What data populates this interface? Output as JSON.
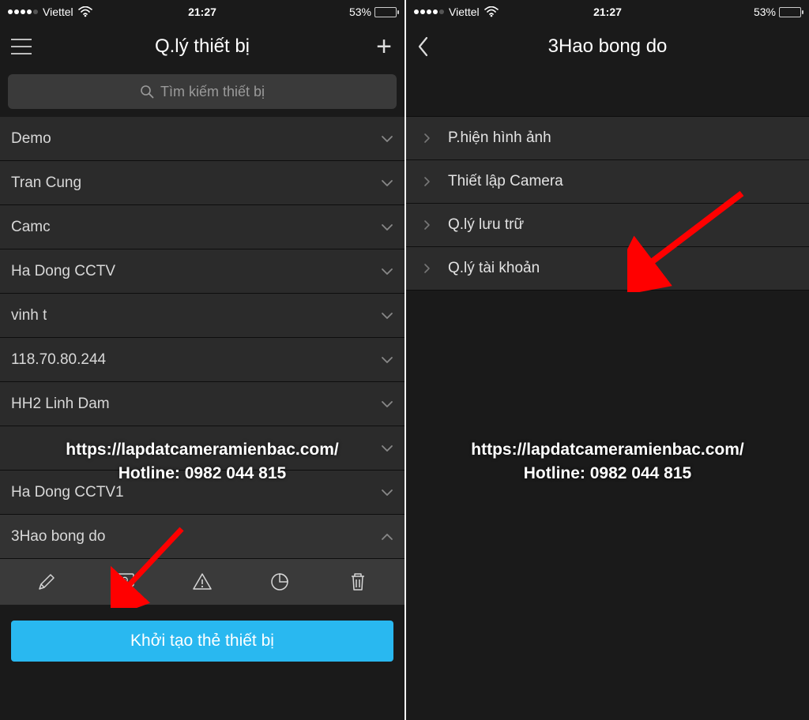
{
  "left": {
    "status": {
      "carrier": "Viettel",
      "time": "21:27",
      "battery_pct": "53%",
      "battery_fill": 53
    },
    "title": "Q.lý thiết bị",
    "search_placeholder": "Tìm kiếm thiết bị",
    "devices": [
      {
        "name": "Demo",
        "expanded": false
      },
      {
        "name": "Tran Cung",
        "expanded": false
      },
      {
        "name": "Camc",
        "expanded": false
      },
      {
        "name": "Ha Dong CCTV",
        "expanded": false
      },
      {
        "name": "vinh t",
        "expanded": false
      },
      {
        "name": "118.70.80.244",
        "expanded": false
      },
      {
        "name": "HH2 Linh Dam",
        "expanded": false
      },
      {
        "name": "",
        "expanded": false
      },
      {
        "name": "Ha Dong CCTV1",
        "expanded": false
      },
      {
        "name": "3Hao bong do",
        "expanded": true
      }
    ],
    "primary_button": "Khởi tạo thẻ thiết bị"
  },
  "right": {
    "status": {
      "carrier": "Viettel",
      "time": "21:27",
      "battery_pct": "53%",
      "battery_fill": 53
    },
    "title": "3Hao bong do",
    "settings": [
      "P.hiện hình ảnh",
      "Thiết lập Camera",
      "Q.lý lưu trữ",
      "Q.lý tài khoản"
    ]
  },
  "watermark": {
    "url": "https://lapdatcameramienbac.com/",
    "hotline": "Hotline: 0982 044 815"
  },
  "icons": {
    "search": "search-icon",
    "menu": "menu-icon",
    "add": "plus-icon",
    "back": "chevron-left-icon",
    "wifi": "wifi-icon",
    "edit": "pencil-icon",
    "monitor": "monitor-gear-icon",
    "alert": "alert-triangle-icon",
    "pie": "pie-chart-icon",
    "trash": "trash-icon"
  },
  "colors": {
    "accent": "#29b8f0",
    "arrow": "#ff0000"
  }
}
